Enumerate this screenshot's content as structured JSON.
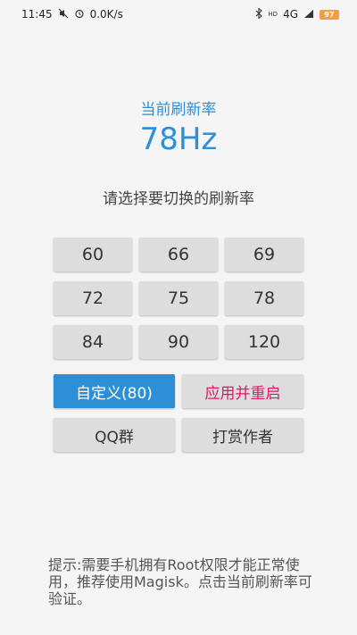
{
  "status_bar": {
    "time": "11:45",
    "speed": "0.0K/s",
    "network": "4G",
    "hd": "HD",
    "battery": "97",
    "icons": [
      "mute-icon",
      "alarm-icon",
      "bluetooth-icon",
      "signal-icon",
      "battery-icon"
    ]
  },
  "header": {
    "title": "当前刷新率",
    "current_rate": "78Hz",
    "prompt": "请选择要切换的刷新率"
  },
  "rates": [
    "60",
    "66",
    "69",
    "72",
    "75",
    "78",
    "84",
    "90",
    "120"
  ],
  "actions": {
    "custom_label": "自定义(80)",
    "apply_label": "应用并重启",
    "qq_label": "QQ群",
    "donate_label": "打赏作者"
  },
  "hint": "提示:需要手机拥有Root权限才能正常使用，推荐使用Magisk。点击当前刷新率可验证。",
  "colors": {
    "accent": "#2d8fd6",
    "apply_text": "#d81b60",
    "button_bg": "#dddddd",
    "background": "#f5f5f5"
  }
}
